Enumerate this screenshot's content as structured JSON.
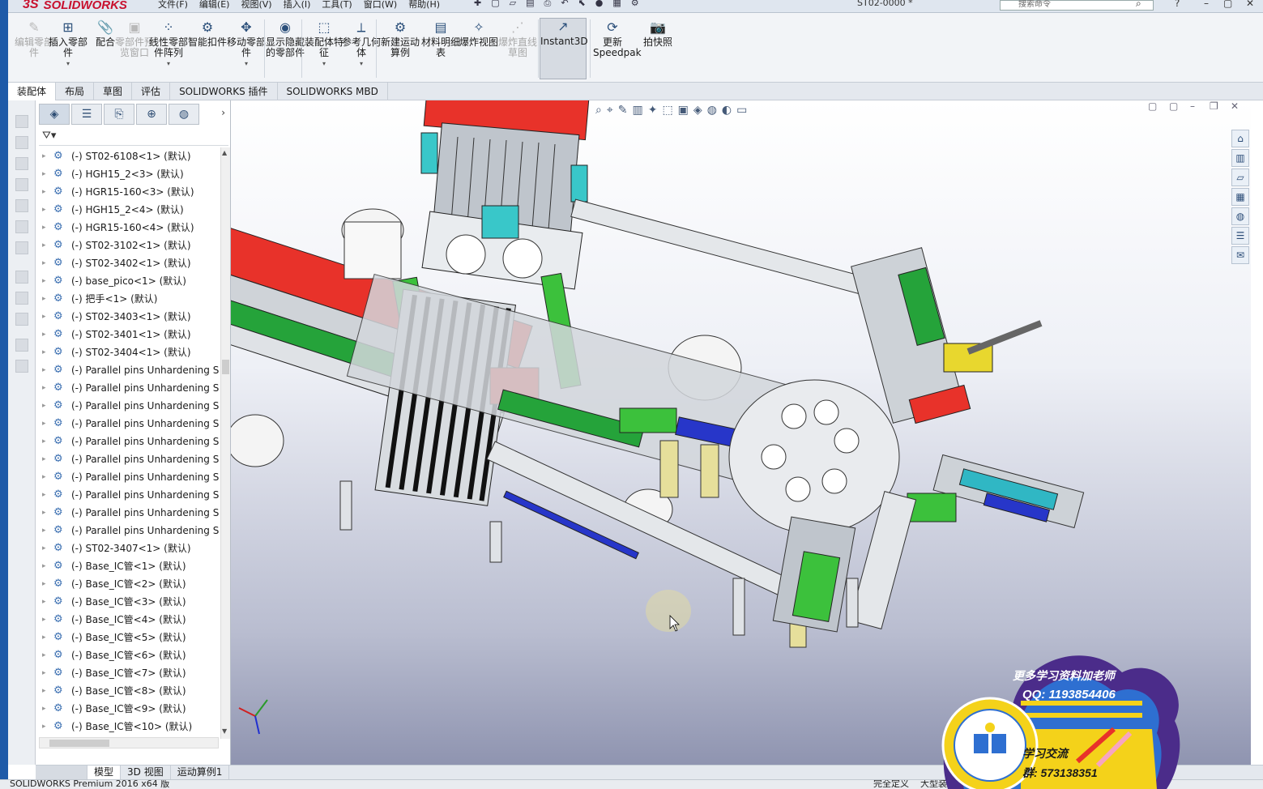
{
  "app": {
    "logo": "SOLIDWORKS",
    "logo_prefix": "3S",
    "document_title": "ST02-0000 *",
    "search_placeholder": "搜索命令"
  },
  "menu": [
    "文件(F)",
    "编辑(E)",
    "视图(V)",
    "插入(I)",
    "工具(T)",
    "窗口(W)",
    "帮助(H)"
  ],
  "ribbon": [
    {
      "label": "编辑零部件",
      "disabled": true,
      "icon": "edit-component-icon",
      "glyph": "✎"
    },
    {
      "label": "插入零部件",
      "disabled": false,
      "icon": "insert-component-icon",
      "glyph": "⊞",
      "dropdown": true
    },
    {
      "label": "配合",
      "disabled": false,
      "icon": "mate-icon",
      "glyph": "📎"
    },
    {
      "label": "零部件预览窗口",
      "disabled": true,
      "icon": "component-preview-icon",
      "glyph": "▣"
    },
    {
      "label": "线性零部件阵列",
      "disabled": false,
      "icon": "linear-pattern-icon",
      "glyph": "⁘",
      "dropdown": true
    },
    {
      "label": "智能扣件",
      "disabled": false,
      "icon": "smart-fastener-icon",
      "glyph": "⚙"
    },
    {
      "label": "移动零部件",
      "disabled": false,
      "icon": "move-component-icon",
      "glyph": "✥",
      "dropdown": true
    },
    {
      "label": "显示隐藏的零部件",
      "disabled": false,
      "icon": "show-hidden-icon",
      "glyph": "◉"
    },
    {
      "label": "装配体特征",
      "disabled": false,
      "icon": "assembly-feature-icon",
      "glyph": "⬚",
      "dropdown": true
    },
    {
      "label": "参考几何体",
      "disabled": false,
      "icon": "reference-geometry-icon",
      "glyph": "⟂",
      "dropdown": true
    },
    {
      "label": "新建运动算例",
      "disabled": false,
      "icon": "motion-study-icon",
      "glyph": "⚙"
    },
    {
      "label": "材料明细表",
      "disabled": false,
      "icon": "bom-icon",
      "glyph": "▤"
    },
    {
      "label": "爆炸视图",
      "disabled": false,
      "icon": "exploded-view-icon",
      "glyph": "✧"
    },
    {
      "label": "爆炸直线草图",
      "disabled": true,
      "icon": "explode-line-sketch-icon",
      "glyph": "⋰"
    },
    {
      "label": "Instant3D",
      "disabled": false,
      "active": true,
      "icon": "instant3d-icon",
      "glyph": "↗"
    },
    {
      "label": "更新Speedpak",
      "disabled": false,
      "icon": "speedpak-icon",
      "glyph": "⟳"
    },
    {
      "label": "拍快照",
      "disabled": false,
      "icon": "snapshot-icon",
      "glyph": "📷"
    }
  ],
  "command_tabs": [
    "装配体",
    "布局",
    "草图",
    "评估",
    "SOLIDWORKS 插件",
    "SOLIDWORKS MBD"
  ],
  "fm_tabs": [
    "featuremanager-icon",
    "propertymanager-icon",
    "configurationmanager-icon",
    "dimxpert-icon",
    "display-manager-icon"
  ],
  "tree": [
    "(-) ST02-6108<1> (默认)",
    "(-) HGH15_2<3> (默认)",
    "(-) HGR15-160<3> (默认)",
    "(-) HGH15_2<4> (默认)",
    "(-) HGR15-160<4> (默认)",
    "(-) ST02-3102<1> (默认)",
    "(-) ST02-3402<1> (默认)",
    "(-) base_pico<1> (默认)",
    "(-) 把手<1> (默认)",
    "(-) ST02-3403<1> (默认)",
    "(-) ST02-3401<1> (默认)",
    "(-) ST02-3404<1> (默认)",
    "(-) Parallel pins Unhardening S",
    "(-) Parallel pins Unhardening S",
    "(-) Parallel pins Unhardening S",
    "(-) Parallel pins Unhardening S",
    "(-) Parallel pins Unhardening S",
    "(-) Parallel pins Unhardening S",
    "(-) Parallel pins Unhardening S",
    "(-) Parallel pins Unhardening S",
    "(-) Parallel pins Unhardening S",
    "(-) Parallel pins Unhardening S",
    "(-) ST02-3407<1> (默认)",
    "(-) Base_IC管<1> (默认)",
    "(-) Base_IC管<2> (默认)",
    "(-) Base_IC管<3> (默认)",
    "(-) Base_IC管<4> (默认)",
    "(-) Base_IC管<5> (默认)",
    "(-) Base_IC管<6> (默认)",
    "(-) Base_IC管<7> (默认)",
    "(-) Base_IC管<8> (默认)",
    "(-) Base_IC管<9> (默认)",
    "(-) Base_IC管<10> (默认)"
  ],
  "bottom_tabs": [
    "模型",
    "3D 视图",
    "运动算例1"
  ],
  "status": {
    "left": "SOLIDWORKS Premium 2016 x64 版",
    "right": "完全定义",
    "right2": "大型装配体"
  },
  "watermark": {
    "line1": "更多学习资料加老师",
    "line2": "QQ: 1193854406",
    "line3": "学习交流",
    "line4": "群: 573138351"
  },
  "colors": {
    "ribbon_bg": "#f2f4f7",
    "accent": "#c8102e",
    "watermark_purple": "#4b2c8a",
    "watermark_yellow": "#f4d21a",
    "watermark_blue": "#2e6fd1"
  }
}
